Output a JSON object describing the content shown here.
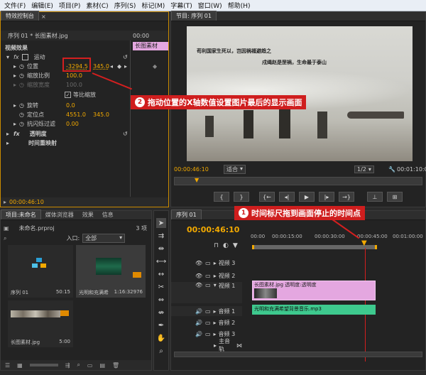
{
  "menu": [
    "文件(F)",
    "编辑(E)",
    "项目(P)",
    "素材(C)",
    "序列(S)",
    "标记(M)",
    "字幕(T)",
    "窗口(W)",
    "帮助(H)"
  ],
  "effect_controls": {
    "tab": "特效控制台",
    "clip_title": "序列 01 * 长图素材.jpg",
    "timecode_head": "00:00",
    "clip_chip": "长图素材",
    "video_effects": "视频效果",
    "motion": "运动",
    "position_label": "位置",
    "position_x": "-3294.5",
    "position_y": "345.0",
    "scale_label": "缩放比例",
    "scale_value": "100.0",
    "scale_width_label": "缩放宽度",
    "scale_width_value": "100.0",
    "uniform_scale": "等比缩放",
    "rotation_label": "旋转",
    "rotation_value": "0.0",
    "anchor_label": "定位点",
    "anchor_x": "4551.0",
    "anchor_y": "345.0",
    "antiflicker_label": "抗闪烁过滤",
    "antiflicker_value": "0.00",
    "opacity": "透明度",
    "time_remap": "时间重映射",
    "timecode": "00:00:46:10"
  },
  "program": {
    "tab": "节目: 序列 01",
    "caption1": "苟利国家生死以，岂因祸福避趋之",
    "caption2": "戍绳赵是罡祸，生命最于泰山",
    "timecode": "00:00:46:10",
    "fit": "适合",
    "ratio": "1/2",
    "duration": "00:01:10:00"
  },
  "project": {
    "tabs": [
      "项目:未命名",
      "媒体浏览器",
      "效果",
      "信息"
    ],
    "file": "未命名.prproj",
    "count": "3 项",
    "entry_label": "入口:",
    "entry_value": "全部",
    "items": [
      {
        "name": "序列 01",
        "duration": "50:15"
      },
      {
        "name": "光明和充满希",
        "duration": "1:16:32976"
      },
      {
        "name": "长图素材.jpg",
        "duration": "5:00"
      }
    ]
  },
  "timeline": {
    "tab": "序列 01",
    "timecode": "00:00:46:10",
    "ruler": [
      "00:00",
      "00:00:15:00",
      "00:00:30:00",
      "00:00:45:00",
      "00:01:00:00"
    ],
    "tracks": [
      "视频 3",
      "视频 2",
      "视频 1",
      "音频 1",
      "音频 2",
      "音频 3",
      "主音轨"
    ],
    "video_clip": "长图素材.jpg 透明度:透明度",
    "audio_clip": "光明和充满希望背景音乐.mp3"
  },
  "annotations": {
    "a1_num": "1",
    "a1_text": "时间标尺拖到画面停止的时间点",
    "a2_num": "2",
    "a2_text": "拖动位置的X轴数值设置图片最后的显示画面"
  },
  "colors": {
    "accent": "#f2a900",
    "annotation": "#cf1e1e",
    "video_clip": "#e4a7e0",
    "audio_clip": "#3ec98e"
  }
}
